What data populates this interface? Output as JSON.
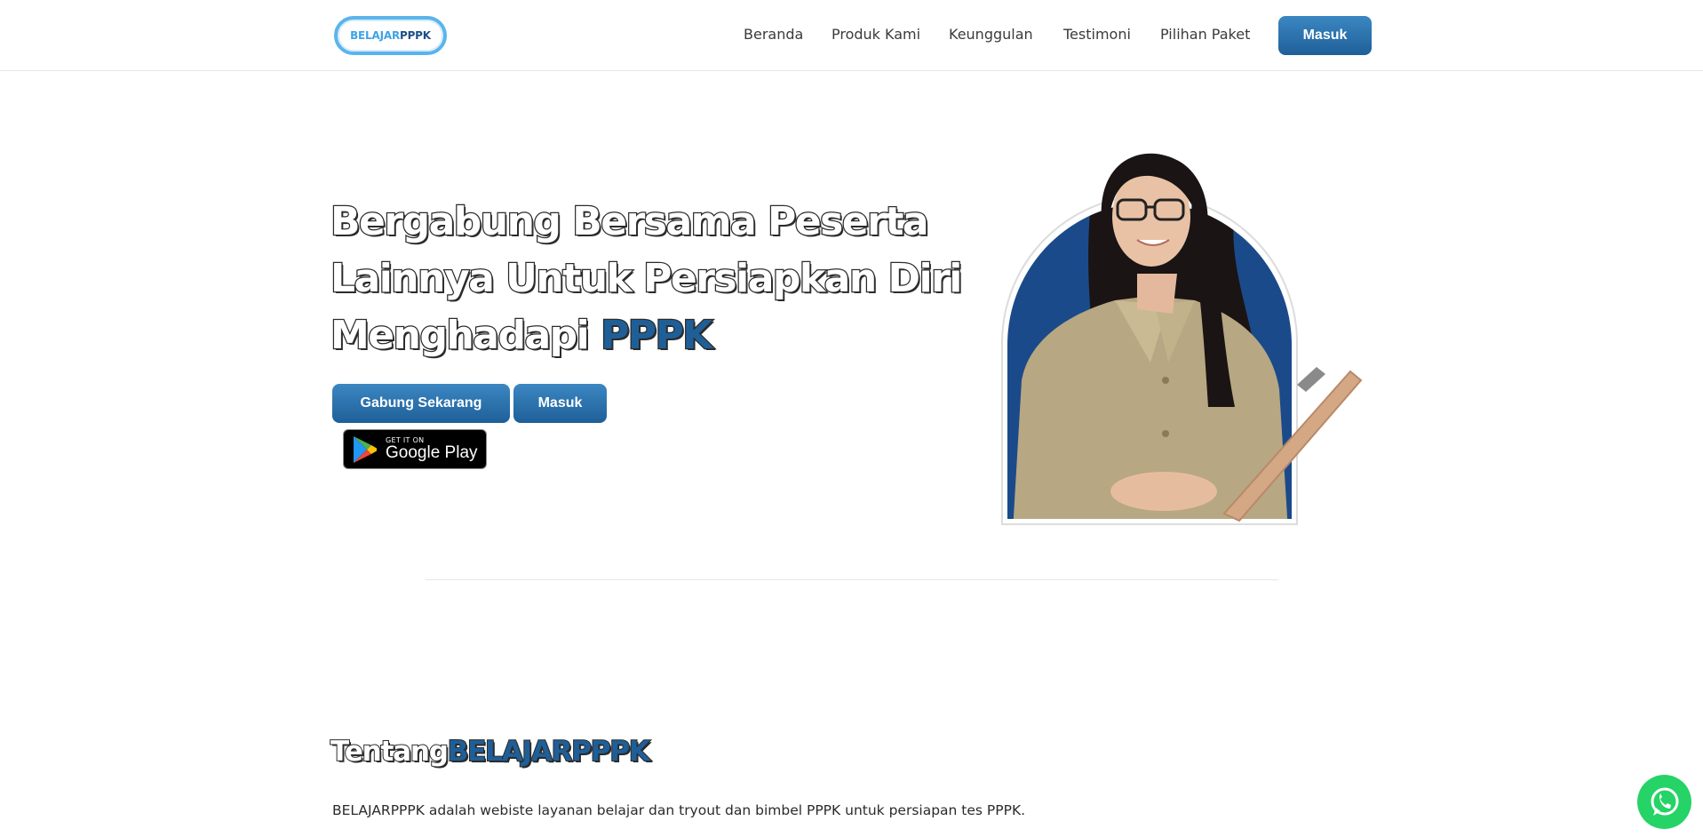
{
  "navbar": {
    "logo": {
      "part1": "BELAJAR",
      "part2": "PPPK"
    },
    "links": [
      "Beranda",
      "Produk Kami",
      "Keunggulan",
      "Testimoni",
      "Pilihan Paket"
    ],
    "login_label": "Masuk"
  },
  "hero": {
    "title_line1": "Bergabung Bersama Peserta",
    "title_line2": "Lainnya Untuk Persiapkan Diri",
    "title_line3_prefix": "Menghadapi",
    "title_line3_accent": "PPPK",
    "join_label": "Gabung Sekarang",
    "login_label": "Masuk",
    "google_play": {
      "small": "GET IT ON",
      "big": "Google Play"
    }
  },
  "about": {
    "title_prefix": "Tentang",
    "title_accent": "BELAJARPPPK",
    "text": "BELAJARPPPK adalah webiste layanan belajar dan tryout dan bimbel PPPK untuk persiapan tes PPPK."
  },
  "colors": {
    "primary": "#1f5f98",
    "primary_light": "#3b87c2",
    "logo_ring": "#5ab4ec",
    "whatsapp": "#25d366"
  },
  "icons": {
    "whatsapp": "whatsapp-icon",
    "google_play": "google-play-icon"
  }
}
